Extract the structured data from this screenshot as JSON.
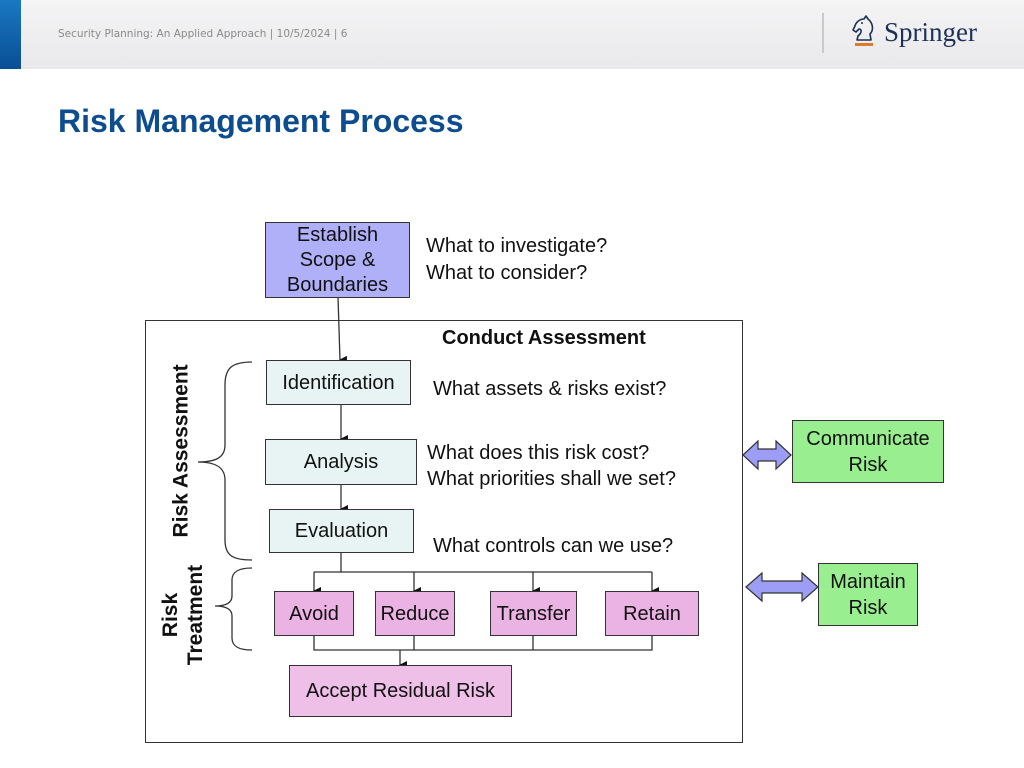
{
  "header": {
    "footer_text": "Security Planning: An Applied Approach | 10/5/2024 | 6",
    "logo_text": "Springer",
    "logo_icon": "knight-chess-icon",
    "brand_color": "#0d4c8f",
    "bar_color": "#1a78c2"
  },
  "slide": {
    "title": "Risk Management Process"
  },
  "diagram": {
    "scope_box": {
      "line1": "Establish",
      "line2": "Scope &",
      "line3": "Boundaries"
    },
    "scope_questions": [
      "What to investigate?",
      "What to consider?"
    ],
    "frame_title": "Conduct Assessment",
    "risk_assessment_label": "Risk Assessment",
    "risk_treatment_label": [
      "Risk",
      "Treatment"
    ],
    "steps": [
      {
        "label": "Identification",
        "questions": [
          "What assets & risks exist?"
        ]
      },
      {
        "label": "Analysis",
        "questions": [
          "What does this risk cost?",
          "What priorities shall we set?"
        ]
      },
      {
        "label": "Evaluation",
        "questions": [
          "What controls can we use?"
        ]
      }
    ],
    "treatments": [
      "Avoid",
      "Reduce",
      "Transfer",
      "Retain"
    ],
    "residual": "Accept Residual Risk",
    "side_boxes": [
      {
        "line1": "Communicate",
        "line2": "Risk"
      },
      {
        "line1": "Maintain",
        "line2": "Risk"
      }
    ],
    "colors": {
      "scope": "#b0b0f8",
      "assessment": "#e8f4f3",
      "treatment": "#eab3e3",
      "side": "#99ef8f",
      "arrow": "#9d9df5"
    }
  }
}
